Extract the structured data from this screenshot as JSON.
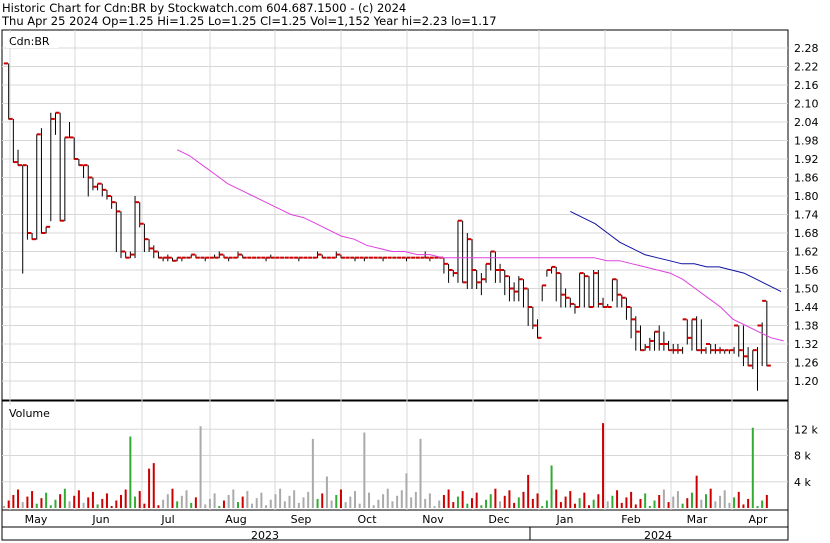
{
  "header": {
    "line1": "Historic Chart for Cdn:BR by Stockwatch.com 604.687.1500 - (c) 2024",
    "line2": "Thu Apr 25 2024   Op=1.25   Hi=1.25   Lo=1.25   Cl=1.25   Vol=1,152   Year hi=2.23   lo=1.17"
  },
  "colors": {
    "price": "#cc0000",
    "ma_short": "#e040e0",
    "ma_long": "#1010a0",
    "vol_up": "#33aa33",
    "vol_down": "#cc0000",
    "vol_flat": "#aaaaaa",
    "grid": "#d8d8d8"
  },
  "chart_data": [
    {
      "type": "line",
      "title": "Cdn:BR",
      "y_ticks": [
        "2.28",
        "2.22",
        "2.16",
        "2.10",
        "2.04",
        "1.98",
        "1.92",
        "1.86",
        "1.80",
        "1.74",
        "1.68",
        "1.62",
        "1.56",
        "1.50",
        "1.44",
        "1.38",
        "1.32",
        "1.26",
        "1.20"
      ],
      "ylim": [
        1.14,
        2.31
      ],
      "x_months": [
        "May",
        "Jun",
        "Jul",
        "Aug",
        "Sep",
        "Oct",
        "Nov",
        "Dec",
        "Jan",
        "Feb",
        "Mar",
        "Apr"
      ],
      "x_years": [
        "2023",
        "2024"
      ],
      "ohlc_step": 3.3,
      "ohlc_start": 1,
      "close": [
        2.23,
        2.05,
        1.91,
        1.9,
        1.9,
        1.68,
        1.66,
        2.0,
        1.68,
        1.7,
        2.05,
        2.07,
        1.72,
        1.99,
        1.99,
        1.92,
        1.9,
        1.9,
        1.86,
        1.83,
        1.84,
        1.82,
        1.8,
        1.78,
        1.75,
        1.62,
        1.6,
        1.61,
        1.78,
        1.71,
        1.66,
        1.63,
        1.62,
        1.6,
        1.6,
        1.6,
        1.59,
        1.6,
        1.6,
        1.6,
        1.61,
        1.6,
        1.6,
        1.6,
        1.6,
        1.6,
        1.61,
        1.6,
        1.6,
        1.6,
        1.61,
        1.6,
        1.6,
        1.6,
        1.6,
        1.6,
        1.6,
        1.6,
        1.6,
        1.6,
        1.6,
        1.6,
        1.6,
        1.6,
        1.6,
        1.6,
        1.6,
        1.61,
        1.6,
        1.6,
        1.6,
        1.61,
        1.6,
        1.6,
        1.6,
        1.6,
        1.6,
        1.6,
        1.6,
        1.6,
        1.6,
        1.6,
        1.6,
        1.6,
        1.6,
        1.6,
        1.6,
        1.6,
        1.6,
        1.6,
        1.6,
        1.6,
        1.6,
        1.6,
        1.58,
        1.56,
        1.55,
        1.72,
        1.52,
        1.66,
        1.56,
        1.52,
        1.53,
        1.58,
        1.62,
        1.56,
        1.56,
        1.54,
        1.5,
        1.49,
        1.53,
        1.5,
        1.44,
        1.38,
        1.34,
        1.51,
        1.56,
        1.57,
        1.55,
        1.48,
        1.47,
        1.45,
        1.44,
        1.55,
        1.54,
        1.44,
        1.55,
        1.45,
        1.44,
        1.44,
        1.53,
        1.48,
        1.47,
        1.44,
        1.4,
        1.36,
        1.3,
        1.31,
        1.33,
        1.36,
        1.32,
        1.32,
        1.3,
        1.3,
        1.3,
        1.4,
        1.34,
        1.4,
        1.3,
        1.3,
        1.32,
        1.3,
        1.3,
        1.3,
        1.3,
        1.3,
        1.38,
        1.3,
        1.28,
        1.25,
        1.3,
        1.38,
        1.46,
        1.25
      ],
      "high": [
        2.23,
        2.23,
        2.05,
        1.95,
        1.9,
        1.9,
        1.68,
        2.0,
        2.02,
        1.7,
        2.07,
        2.07,
        2.07,
        1.99,
        2.04,
        1.99,
        1.92,
        1.9,
        1.9,
        1.86,
        1.84,
        1.84,
        1.82,
        1.8,
        1.78,
        1.75,
        1.62,
        1.62,
        1.8,
        1.78,
        1.71,
        1.66,
        1.64,
        1.62,
        1.6,
        1.61,
        1.6,
        1.6,
        1.6,
        1.6,
        1.61,
        1.61,
        1.6,
        1.6,
        1.6,
        1.61,
        1.62,
        1.61,
        1.6,
        1.6,
        1.62,
        1.61,
        1.6,
        1.6,
        1.6,
        1.6,
        1.6,
        1.61,
        1.6,
        1.6,
        1.6,
        1.6,
        1.6,
        1.6,
        1.6,
        1.6,
        1.6,
        1.62,
        1.61,
        1.6,
        1.6,
        1.62,
        1.61,
        1.6,
        1.6,
        1.6,
        1.6,
        1.6,
        1.6,
        1.6,
        1.6,
        1.6,
        1.6,
        1.6,
        1.6,
        1.6,
        1.6,
        1.6,
        1.6,
        1.6,
        1.62,
        1.6,
        1.6,
        1.6,
        1.6,
        1.58,
        1.56,
        1.72,
        1.72,
        1.68,
        1.66,
        1.56,
        1.55,
        1.58,
        1.62,
        1.62,
        1.58,
        1.56,
        1.54,
        1.52,
        1.54,
        1.53,
        1.5,
        1.44,
        1.4,
        1.51,
        1.56,
        1.57,
        1.57,
        1.55,
        1.5,
        1.47,
        1.45,
        1.55,
        1.55,
        1.54,
        1.56,
        1.56,
        1.47,
        1.45,
        1.53,
        1.53,
        1.48,
        1.47,
        1.44,
        1.41,
        1.38,
        1.32,
        1.34,
        1.36,
        1.38,
        1.36,
        1.33,
        1.32,
        1.32,
        1.31,
        1.4,
        1.4,
        1.41,
        1.4,
        1.31,
        1.32,
        1.32,
        1.31,
        1.3,
        1.3,
        1.31,
        1.38,
        1.38,
        1.31,
        1.3,
        1.31,
        1.39,
        1.46,
        1.46
      ],
      "low": [
        2.23,
        2.05,
        1.91,
        1.9,
        1.55,
        1.66,
        1.66,
        1.66,
        1.68,
        1.68,
        1.72,
        2.0,
        1.72,
        1.72,
        1.99,
        1.92,
        1.9,
        1.86,
        1.8,
        1.82,
        1.82,
        1.8,
        1.79,
        1.76,
        1.62,
        1.6,
        1.6,
        1.6,
        1.6,
        1.7,
        1.62,
        1.62,
        1.6,
        1.6,
        1.59,
        1.59,
        1.59,
        1.59,
        1.59,
        1.6,
        1.6,
        1.6,
        1.6,
        1.59,
        1.6,
        1.6,
        1.6,
        1.6,
        1.59,
        1.6,
        1.6,
        1.6,
        1.6,
        1.6,
        1.6,
        1.6,
        1.59,
        1.6,
        1.6,
        1.6,
        1.6,
        1.6,
        1.6,
        1.59,
        1.6,
        1.6,
        1.6,
        1.6,
        1.6,
        1.6,
        1.6,
        1.6,
        1.6,
        1.6,
        1.6,
        1.59,
        1.6,
        1.59,
        1.6,
        1.6,
        1.6,
        1.59,
        1.6,
        1.6,
        1.6,
        1.6,
        1.59,
        1.6,
        1.6,
        1.6,
        1.6,
        1.59,
        1.6,
        1.6,
        1.55,
        1.52,
        1.54,
        1.52,
        1.52,
        1.5,
        1.5,
        1.5,
        1.48,
        1.52,
        1.56,
        1.52,
        1.52,
        1.48,
        1.46,
        1.46,
        1.46,
        1.44,
        1.38,
        1.37,
        1.34,
        1.46,
        1.54,
        1.55,
        1.46,
        1.44,
        1.44,
        1.44,
        1.42,
        1.44,
        1.44,
        1.44,
        1.44,
        1.44,
        1.44,
        1.44,
        1.46,
        1.44,
        1.44,
        1.4,
        1.34,
        1.3,
        1.3,
        1.3,
        1.3,
        1.3,
        1.3,
        1.3,
        1.3,
        1.29,
        1.29,
        1.29,
        1.32,
        1.3,
        1.3,
        1.29,
        1.29,
        1.29,
        1.29,
        1.29,
        1.29,
        1.29,
        1.29,
        1.28,
        1.25,
        1.25,
        1.24,
        1.17,
        1.25,
        1.25,
        1.24
      ],
      "ma_short": {
        "start": 37,
        "values": [
          1.95,
          1.93,
          1.9,
          1.87,
          1.84,
          1.82,
          1.8,
          1.78,
          1.76,
          1.74,
          1.73,
          1.71,
          1.69,
          1.67,
          1.66,
          1.64,
          1.63,
          1.62,
          1.62,
          1.61,
          1.61,
          1.6,
          1.6,
          1.6,
          1.6,
          1.6,
          1.6,
          1.6,
          1.6,
          1.6,
          1.6,
          1.6,
          1.6,
          1.6,
          1.59,
          1.59,
          1.58,
          1.57,
          1.56,
          1.55,
          1.53,
          1.5,
          1.47,
          1.44,
          1.4,
          1.38,
          1.36,
          1.34,
          1.33
        ]
      },
      "ma_long": {
        "start": 121,
        "values": [
          1.75,
          1.73,
          1.71,
          1.68,
          1.65,
          1.63,
          1.61,
          1.6,
          1.59,
          1.58,
          1.58,
          1.57,
          1.57,
          1.56,
          1.55,
          1.53,
          1.51,
          1.49
        ]
      },
      "volume_ticks": [
        "12 k",
        "8 k",
        "4 k"
      ],
      "volume_max": 16000
    }
  ]
}
